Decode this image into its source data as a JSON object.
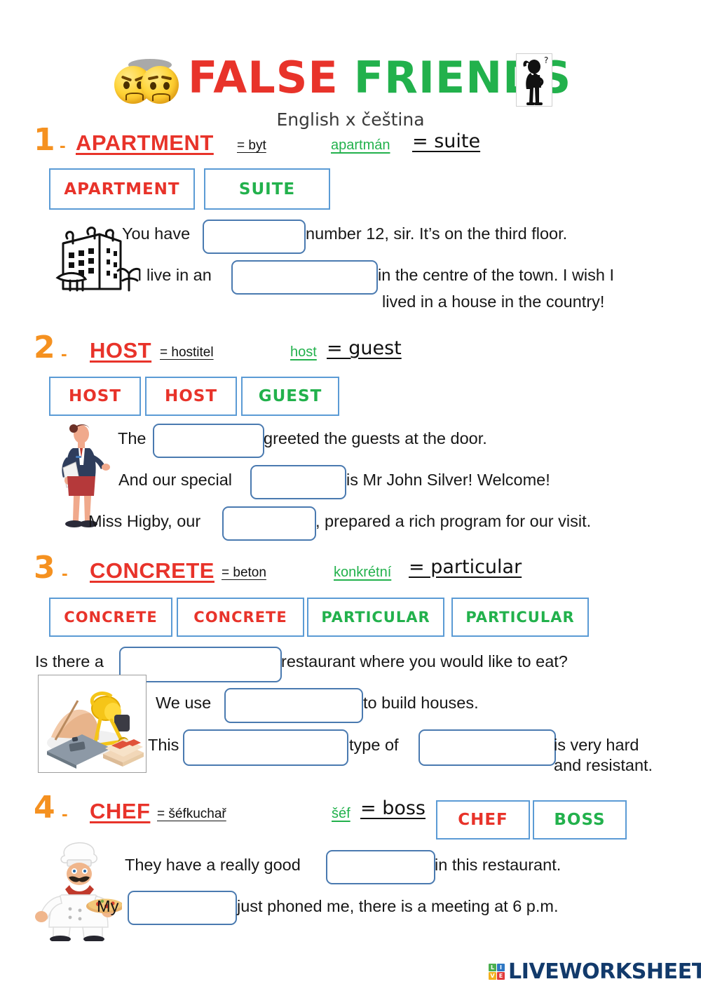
{
  "header": {
    "title_part1": "FALSE",
    "title_part2": "FRIENDS",
    "subtitle": "English  x  čeština",
    "colors": {
      "red": "#e8332a",
      "green": "#22b14c",
      "orange": "#f59120",
      "blue_border": "#5b9bd5",
      "input_border": "#4a7ab0"
    },
    "emoji_left": "angry-face-emoji",
    "emoji_right": "annoyed-face-emoji",
    "thinker_icon": "confused-person-icon"
  },
  "sections": [
    {
      "number": "1",
      "dash": "-",
      "en_word": "APARTMENT",
      "en_translation": "= byt",
      "cz_word": "apartmán",
      "cz_translation": "= suite",
      "illustration": "apartment-building-illustration",
      "chips": [
        {
          "label": "APARTMENT",
          "color": "red"
        },
        {
          "label": "SUITE",
          "color": "green"
        }
      ],
      "lines": [
        [
          {
            "t": "text",
            "v": "You have "
          },
          {
            "t": "blank"
          },
          {
            "t": "text",
            "v": "number 12, sir. It’s on the third floor."
          }
        ],
        [
          {
            "t": "text",
            "v": "I live in an "
          },
          {
            "t": "blank"
          },
          {
            "t": "text",
            "v": "in the centre of the town. I wish I"
          }
        ],
        [
          {
            "t": "text",
            "v": "lived in a house in the country!"
          }
        ]
      ]
    },
    {
      "number": "2",
      "dash": "-",
      "en_word": "HOST",
      "en_translation": "= hostitel",
      "cz_word": "host",
      "cz_translation": "= guest",
      "illustration": "hostess-woman-illustration",
      "chips": [
        {
          "label": "HOST",
          "color": "red"
        },
        {
          "label": "HOST",
          "color": "red"
        },
        {
          "label": "GUEST",
          "color": "green"
        }
      ],
      "lines": [
        [
          {
            "t": "text",
            "v": "The "
          },
          {
            "t": "blank"
          },
          {
            "t": "text",
            "v": "greeted the guests at the door."
          }
        ],
        [
          {
            "t": "text",
            "v": "And our special "
          },
          {
            "t": "blank"
          },
          {
            "t": "text",
            "v": "is Mr John Silver! Welcome!"
          }
        ],
        [
          {
            "t": "text",
            "v": "Miss Higby, our "
          },
          {
            "t": "blank"
          },
          {
            "t": "text",
            "v": ", prepared a rich program for our visit."
          }
        ]
      ]
    },
    {
      "number": "3",
      "dash": "-",
      "en_word": "CONCRETE",
      "en_translation": "= beton",
      "cz_word": "konkrétní",
      "cz_translation": "= particular",
      "illustration": "cement-mixer-illustration",
      "chips": [
        {
          "label": "CONCRETE",
          "color": "red"
        },
        {
          "label": "CONCRETE",
          "color": "red"
        },
        {
          "label": "PARTICULAR",
          "color": "green"
        },
        {
          "label": "PARTICULAR",
          "color": "green"
        }
      ],
      "lines": [
        [
          {
            "t": "text",
            "v": "Is there a "
          },
          {
            "t": "blank"
          },
          {
            "t": "text",
            "v": "restaurant where you would like to eat?"
          }
        ],
        [
          {
            "t": "text",
            "v": "We use "
          },
          {
            "t": "blank"
          },
          {
            "t": "text",
            "v": "to build houses."
          }
        ],
        [
          {
            "t": "text",
            "v": "This "
          },
          {
            "t": "blank"
          },
          {
            "t": "text",
            "v": "type of "
          },
          {
            "t": "blank"
          },
          {
            "t": "text",
            "v": "is very hard"
          }
        ],
        [
          {
            "t": "text",
            "v": "and resistant."
          }
        ]
      ]
    },
    {
      "number": "4",
      "dash": "-",
      "en_word": "CHEF",
      "en_translation": "= šéfkuchař",
      "cz_word": "šéf",
      "cz_translation": "= boss",
      "illustration": "chef-with-pizza-illustration",
      "chips": [
        {
          "label": "CHEF",
          "color": "red"
        },
        {
          "label": "BOSS",
          "color": "green"
        }
      ],
      "lines": [
        [
          {
            "t": "text",
            "v": "They have a really good "
          },
          {
            "t": "blank"
          },
          {
            "t": "text",
            "v": "in this restaurant."
          }
        ],
        [
          {
            "t": "text",
            "v": "My "
          },
          {
            "t": "blank"
          },
          {
            "t": "text",
            "v": "just phoned me, there is a meeting at 6 p.m."
          }
        ]
      ]
    }
  ],
  "footer": {
    "brand": "LIVEWORKSHEETS",
    "tiles": [
      {
        "letter": "L",
        "color": "#4caf50"
      },
      {
        "letter": "I",
        "color": "#2f78c4"
      },
      {
        "letter": "V",
        "color": "#f2b01e"
      },
      {
        "letter": "E",
        "color": "#e03b3b"
      }
    ]
  }
}
